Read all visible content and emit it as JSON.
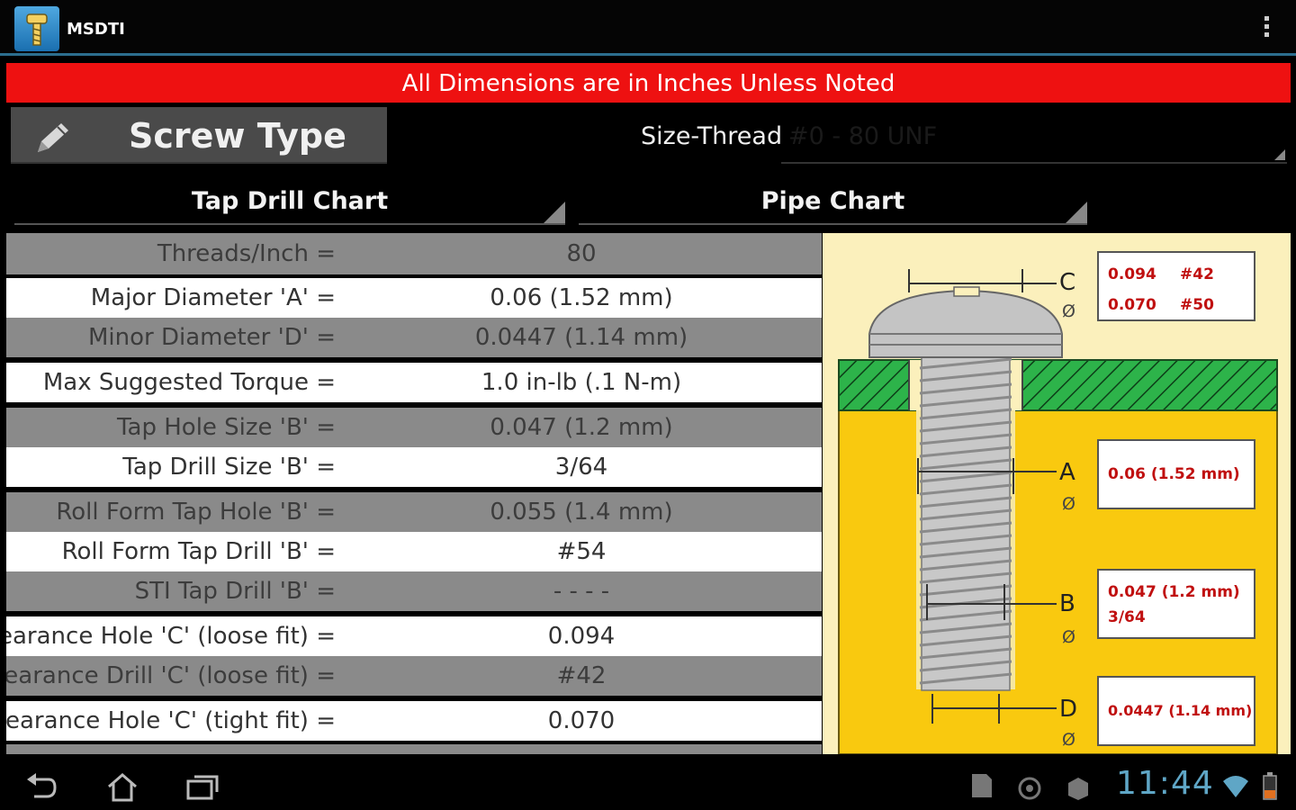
{
  "app": {
    "title": "MSDTI"
  },
  "banner": {
    "text": "All Dimensions are in Inches Unless Noted"
  },
  "screw": {
    "label": "Screw Type"
  },
  "size_thread": {
    "label": "Size-Thread",
    "value": "#0 - 80 UNF"
  },
  "charts": {
    "tap": "Tap Drill Chart",
    "pipe": "Pipe Chart"
  },
  "rows": [
    {
      "label": "Threads/Inch =",
      "value": "80"
    },
    {
      "label": "Major Diameter 'A' =",
      "value": "0.06 (1.52 mm)"
    },
    {
      "label": "Minor Diameter 'D' =",
      "value": "0.0447 (1.14 mm)"
    },
    {
      "label": "Max Suggested Torque =",
      "value": "1.0 in-lb (.1 N-m)"
    },
    {
      "label": "Tap Hole Size 'B' =",
      "value": "0.047 (1.2 mm)"
    },
    {
      "label": "Tap Drill Size 'B' =",
      "value": "3/64"
    },
    {
      "label": "Roll Form Tap Hole 'B' =",
      "value": "0.055 (1.4 mm)"
    },
    {
      "label": "Roll Form Tap Drill 'B' =",
      "value": "#54"
    },
    {
      "label": "STI Tap Drill 'B' =",
      "value": "- - - -"
    },
    {
      "label": "Clearance Hole 'C' (loose fit) =",
      "value": "0.094"
    },
    {
      "label": "Clearance Drill 'C' (loose fit) =",
      "value": "#42"
    },
    {
      "label": "Clearance Hole 'C' (tight fit) =",
      "value": "0.070"
    }
  ],
  "diagram": {
    "letters": {
      "c": "C",
      "a": "A",
      "b": "B",
      "d": "D",
      "phi": "Ø"
    },
    "box_c": {
      "line1_val": "0.094",
      "line1_drill": "#42",
      "line2_val": "0.070",
      "line2_drill": "#50"
    },
    "box_a": {
      "text": "0.06 (1.52 mm)"
    },
    "box_b": {
      "line1": "0.047 (1.2 mm)",
      "line2": "3/64"
    },
    "box_d": {
      "text": "0.0447 (1.14 mm)"
    }
  },
  "status": {
    "time": "11:44"
  },
  "colors": {
    "banner": "#ee1111",
    "accent": "#2c6e8e",
    "diagram_bg": "#fbf0bc",
    "yellow": "#f9c90f",
    "green": "#2db34a",
    "dim_text": "#c01010"
  }
}
